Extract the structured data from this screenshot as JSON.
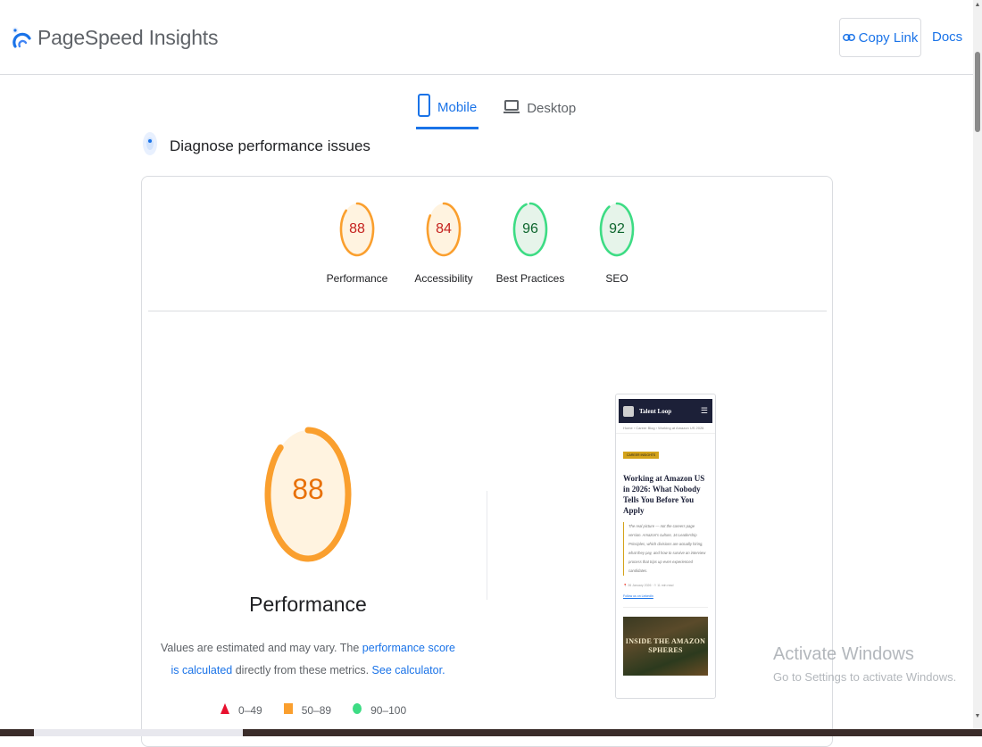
{
  "header": {
    "app_title": "PageSpeed Insights",
    "copy_link_label": "Copy Link",
    "docs_label": "Docs"
  },
  "tabs": [
    {
      "label": "Mobile",
      "active": true
    },
    {
      "label": "Desktop",
      "active": false
    }
  ],
  "section_title": "Diagnose performance issues",
  "scores": [
    {
      "label": "Performance",
      "value": 88,
      "color": "#fa9f2e",
      "text_color": "#c5221f"
    },
    {
      "label": "Accessibility",
      "value": 84,
      "color": "#fa9f2e",
      "text_color": "#c5221f"
    },
    {
      "label": "Best Practices",
      "value": 96,
      "color": "#3ddc84",
      "text_color": "#0d652d"
    },
    {
      "label": "SEO",
      "value": 92,
      "color": "#3ddc84",
      "text_color": "#0d652d"
    }
  ],
  "performance": {
    "score": 88,
    "title": "Performance",
    "note_part1": "Values are estimated and may vary. The ",
    "note_link1": "performance score is calculated",
    "note_part2": " directly from these metrics. ",
    "note_link2": "See calculator."
  },
  "legend": [
    {
      "range": "0–49",
      "shape": "triangle",
      "color": "#e8102e"
    },
    {
      "range": "50–89",
      "shape": "square",
      "color": "#fa9f2e"
    },
    {
      "range": "90–100",
      "shape": "circle",
      "color": "#3ddc84"
    }
  ],
  "screenshot": {
    "site_name": "Talent Loop",
    "breadcrumb": "Home › Career Blog › Working at Amazon US 2026",
    "badge": "CAREER INSIGHTS",
    "headline": "Working at Amazon US in 2026: What Nobody Tells You Before You Apply",
    "description": "The real picture — not the careers page version. Amazon's culture, 16 Leadership Principles, which divisions are actually hiring, what they pay, and how to survive an interview process that trips up even experienced candidates.",
    "meta": "📍 26 January 2026 · ⏱ 11 min read",
    "follow": "Follow us on LinkedIn",
    "image_caption": "INSIDE THE AMAZON SPHERES"
  },
  "watermark": {
    "title": "Activate Windows",
    "subtitle": "Go to Settings to activate Windows."
  },
  "colors": {
    "accent": "#1a73e8",
    "average": "#fa9f2e",
    "good": "#3ddc84",
    "poor": "#e8102e"
  }
}
